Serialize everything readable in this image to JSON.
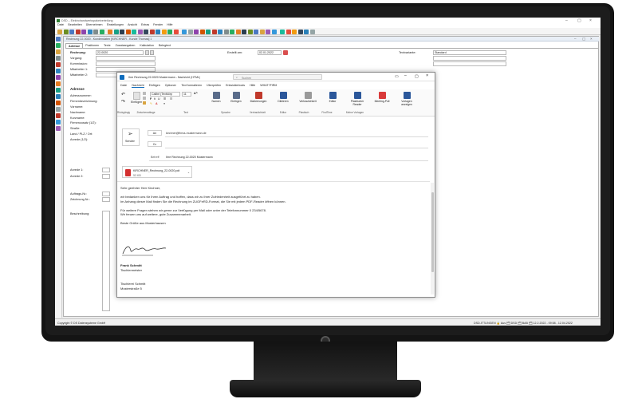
{
  "app": {
    "title": "DSD – Elektrohandwerkspaketverteilung",
    "menu": [
      "Datei",
      "Bearbeiten",
      "Übernehmen",
      "Einstellungen",
      "Ansicht",
      "Extras",
      "Fenster",
      "Hilfe"
    ],
    "doc_tab": "Rechnung 22-0020 - Kundendaten [KIRCHNER - Kunde Thomas] 1",
    "form_tabs": [
      "Adresse",
      "Positionen",
      "Texte",
      "Zusatzangaben",
      "Kalkulation",
      "Belegtext"
    ],
    "fields": {
      "rechnung_label": "Rechnung:",
      "rechnung_value": "22-0020",
      "vorgang_label": "Vorgang:",
      "kommission_label": "Kommission:",
      "mitarbeiter1_label": "Mitarbeiter 1:",
      "mitarbeiter2_label": "Mitarbeiter 2:",
      "erstellt_label": "Erstellt am:",
      "erstellt_value": "02.01.2022",
      "textvariante_label": "Textvariante:",
      "textvariante_value": "Standard"
    },
    "address_section": "Adresse",
    "address_labels": [
      "Adressnummer:",
      "Firmenbezeichnung:",
      "Vorname:",
      "Nachname:",
      "Kurzname:",
      "Firmenzusatz (1/2):",
      "Straße:",
      "Land / PLZ / Ort:",
      "Anrede (1/2):"
    ],
    "lower_labels": [
      "Anrede 1:",
      "Anrede 2:"
    ],
    "auftrag_label": "Auftrags-Nr.:",
    "zeichnung_label": "Zeichnung Nr.:",
    "beschreibung_label": "Beschreibung:",
    "status_left": "Copyright © DS Datensysteme GmbH",
    "status_right": "DSD-ITTLINGEN  🔒 Aus  🗂 DSD  🗂 BAB  🗂 12.2.2022 - 09:58 - 12.04.2022"
  },
  "outlook": {
    "title": "Ihre Rechnung 22-0020 Mustermann  -  Nachricht (HTML)",
    "search_placeholder": "Suchen",
    "menu": [
      "Datei",
      "Nachricht",
      "Einfügen",
      "Optionen",
      "Text formatieren",
      "Überprüfen",
      "Entwicklertools",
      "Hilfe",
      "WHAT?FIRM"
    ],
    "font_name": "Calibri (Textkörp",
    "font_size": "11",
    "ribbon_buttons": [
      {
        "label": "Namen",
        "color": "#5a6c8a"
      },
      {
        "label": "Einfügen",
        "color": "#5a6c8a"
      },
      {
        "label": "Markierungen",
        "color": "#c0392b"
      },
      {
        "label": "Diktieren",
        "color": "#2b579a"
      },
      {
        "label": "Vertraulichkeit",
        "color": "#9a9a9a"
      },
      {
        "label": "Editor",
        "color": "#2b579a"
      },
      {
        "label": "Plastischer Reader",
        "color": "#2b579a"
      },
      {
        "label": "Meeting-Poll",
        "color": "#d93a3a"
      },
      {
        "label": "Vorlagen anzeigen",
        "color": "#2b579a"
      }
    ],
    "group_labels": [
      "Rückgängig",
      "Zwischenablage",
      "Text",
      "Sprache",
      "Vertraulichkeit",
      "Editor",
      "Plastisch",
      "FindTime",
      "Meine Vorlagen"
    ],
    "send_label": "Senden",
    "to_label": "An",
    "to_value": "kirchner@firma-mustermann.de",
    "cc_label": "Cc",
    "subject_label": "Betreff",
    "subject_value": "Ihre Rechnung 22-0020 Mustermann",
    "attachment_name": "KIRCHNER_Rechnung_22-0020.pdf",
    "attachment_size": "53 KB",
    "body": [
      "Sehr geehrter Herr Kirchner,",
      "",
      "wir bedanken uns für Ihren Auftrag und hoffen, dass wir zu Ihrer Zufriedenheit ausgeführt zu haben.",
      "Im Anhang dieser Mail finden Sie die Rechnung im ZUGFeRD-Format, die Sie mit jedem PDF-Reader öffnen können.",
      "",
      "Für weitere Fragen stehen wir gerne zur Verfügung per Mail oder unter der Telefonnummer 0 234/5678.",
      "Wir freuen uns auf weitere, gute Zusammenarbeit.",
      "",
      "Beste Grüße aus Musterhausen"
    ],
    "sign_name": "Frank Schmitt",
    "sign_title": "Tischlermeister",
    "sign_company": "Tischlerei Schmitt",
    "sign_street": "Musterstraße 5"
  }
}
